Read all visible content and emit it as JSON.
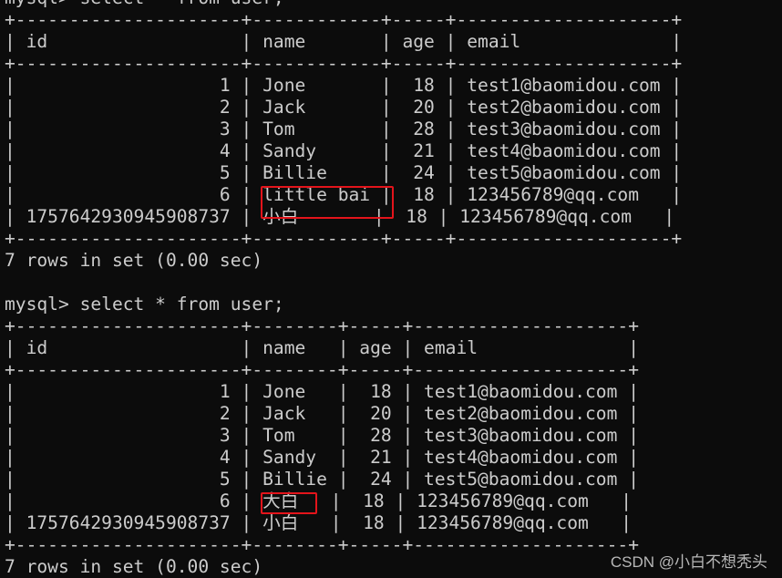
{
  "terminal": {
    "prompt": "mysql> ",
    "query": "select * from user;",
    "queries": [
      {
        "columns": [
          "id",
          "name",
          "age",
          "email"
        ],
        "rows": [
          {
            "id": "1",
            "name": "Jone",
            "age": "18",
            "email": "test1@baomidou.com"
          },
          {
            "id": "2",
            "name": "Jack",
            "age": "20",
            "email": "test2@baomidou.com"
          },
          {
            "id": "3",
            "name": "Tom",
            "age": "28",
            "email": "test3@baomidou.com"
          },
          {
            "id": "4",
            "name": "Sandy",
            "age": "21",
            "email": "test4@baomidou.com"
          },
          {
            "id": "5",
            "name": "Billie",
            "age": "24",
            "email": "test5@baomidou.com"
          },
          {
            "id": "6",
            "name": "little bai",
            "age": "18",
            "email": "123456789@qq.com",
            "highlighted": true
          },
          {
            "id": "1757642930945908737",
            "name": "小白",
            "age": "18",
            "email": "123456789@qq.com"
          }
        ],
        "summary": "7 rows in set (0.00 sec)"
      },
      {
        "columns": [
          "id",
          "name",
          "age",
          "email"
        ],
        "rows": [
          {
            "id": "1",
            "name": "Jone",
            "age": "18",
            "email": "test1@baomidou.com"
          },
          {
            "id": "2",
            "name": "Jack",
            "age": "20",
            "email": "test2@baomidou.com"
          },
          {
            "id": "3",
            "name": "Tom",
            "age": "28",
            "email": "test3@baomidou.com"
          },
          {
            "id": "4",
            "name": "Sandy",
            "age": "21",
            "email": "test4@baomidou.com"
          },
          {
            "id": "5",
            "name": "Billie",
            "age": "24",
            "email": "test5@baomidou.com"
          },
          {
            "id": "6",
            "name": "大白",
            "age": "18",
            "email": "123456789@qq.com",
            "highlighted": true
          },
          {
            "id": "1757642930945908737",
            "name": "小白",
            "age": "18",
            "email": "123456789@qq.com"
          }
        ],
        "summary": "7 rows in set (0.00 sec)"
      }
    ]
  },
  "colors": {
    "background": "#0c0c0c",
    "text": "#cccccc",
    "highlight_box": "#e3141b"
  },
  "watermark": "CSDN @小白不想秃头"
}
